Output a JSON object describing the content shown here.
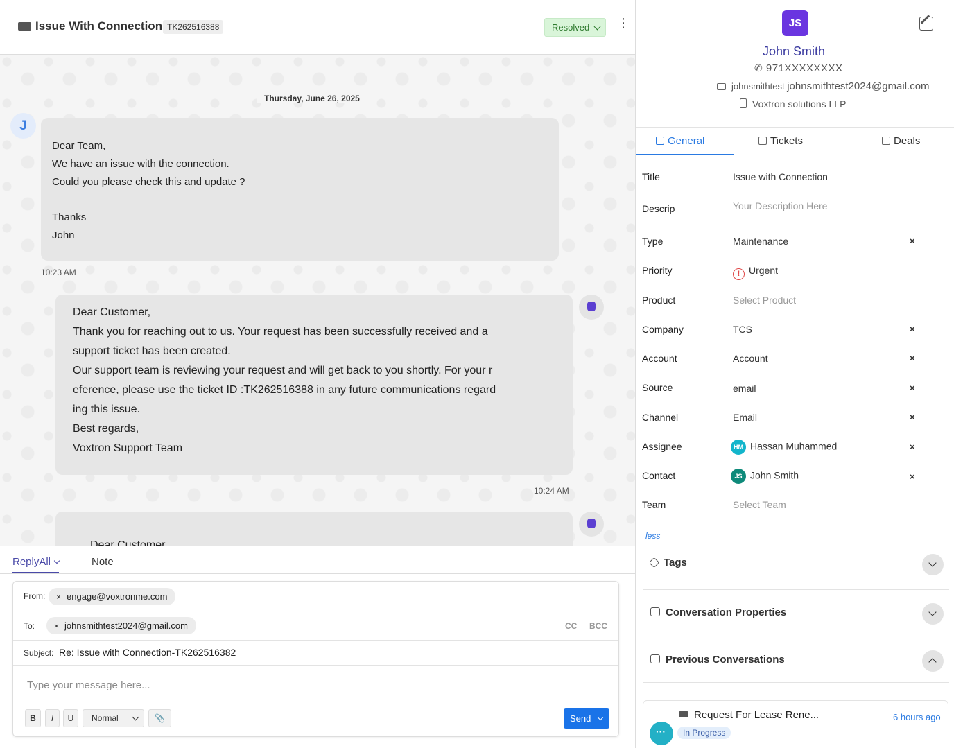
{
  "header": {
    "title": "Issue With Connection",
    "ticket_id": "TK262516388",
    "status": "Resolved"
  },
  "chat": {
    "date": "Thursday, June 26, 2025",
    "avatar_initial": "J",
    "message1": {
      "lines": [
        "Dear Team,",
        "We have an issue with the connection.",
        "Could you please check this and update ?",
        "",
        "Thanks",
        "John"
      ],
      "time": "10:23 AM"
    },
    "message2": {
      "lines": [
        "Dear Customer,",
        "Thank you for reaching out to us. Your request has been successfully received and a",
        "support ticket has been created.",
        "Our support team is reviewing your request and will get back to you shortly. For your r",
        "eference, please use the ticket ID :TK262516388 in any future communications regard",
        "ing this issue.",
        "Best regards,",
        "Voxtron Support Team"
      ],
      "time": "10:24 AM"
    },
    "message3_preview": "Dear Customer"
  },
  "compose": {
    "tab_reply": "ReplyAll",
    "tab_note": "Note",
    "from_label": "From:",
    "from_value": "engage@voxtronme.com",
    "to_label": "To:",
    "to_value": "johnsmithtest2024@gmail.com",
    "cc": "CC",
    "bcc": "BCC",
    "subject_label": "Subject:",
    "subject_value": "Re: Issue with Connection-TK262516382",
    "placeholder": "Type your message here...",
    "bold": "B",
    "italic": "I",
    "underline": "U",
    "format": "Normal",
    "send": "Send"
  },
  "contact": {
    "initials": "JS",
    "name": "John Smith",
    "phone": "971XXXXXXXX",
    "email_short": "johnsmithtest",
    "email": "johnsmithtest2024@gmail.com",
    "company": "Voxtron solutions LLP"
  },
  "tabs": {
    "general": "General",
    "tickets": "Tickets",
    "deals": "Deals"
  },
  "fields": [
    {
      "label": "Title",
      "value": "Issue with Connection",
      "placeholder": false,
      "clear": false
    },
    {
      "label": "Descrip",
      "value": "Your Description Here",
      "placeholder": true,
      "clear": false
    },
    {
      "label": "Type",
      "value": "Maintenance",
      "placeholder": false,
      "clear": true
    },
    {
      "label": "Priority",
      "value": "Urgent",
      "placeholder": false,
      "clear": false
    },
    {
      "label": "Product",
      "value": "Select Product",
      "placeholder": true,
      "clear": false
    },
    {
      "label": "Company",
      "value": "TCS",
      "placeholder": false,
      "clear": true
    },
    {
      "label": "Account",
      "value": "Account",
      "placeholder": false,
      "clear": true
    },
    {
      "label": "Source",
      "value": "email",
      "placeholder": false,
      "clear": true
    },
    {
      "label": "Channel",
      "value": "Email",
      "placeholder": false,
      "clear": true
    },
    {
      "label": "Assignee",
      "value": "Hassan Muhammed",
      "avatar": "HM",
      "placeholder": false,
      "clear": true
    },
    {
      "label": "Contact",
      "value": "John Smith",
      "avatar": "JS",
      "placeholder": false,
      "clear": true
    },
    {
      "label": "Team",
      "value": "Select Team",
      "placeholder": true,
      "clear": false
    }
  ],
  "clear_symbol": "×",
  "urgent_symbol": "!",
  "less_link": "less",
  "sections": {
    "tags": "Tags",
    "conv_props": "Conversation Properties",
    "prev_conv": "Previous Conversations"
  },
  "previous": {
    "title": "Request For Lease Rene...",
    "time": "6 hours ago",
    "status": "In Progress"
  },
  "colors": {
    "accent": "#2a7ae2",
    "status_resolved_bg": "#d9f5d9",
    "avatar_purple": "#6a35e0",
    "assignee_avatar": "#12b5cb",
    "contact_avatar": "#0e8a7a"
  },
  "icons": {
    "ticket": "ticket-icon",
    "kebab": "kebab-menu-icon",
    "bot": "bot-icon",
    "phone": "phone-icon",
    "mail": "mail-icon",
    "building": "building-icon",
    "edit": "edit-icon",
    "tag": "tag-icon",
    "chat": "chat-bubble-icon",
    "attach": "paperclip-icon"
  }
}
